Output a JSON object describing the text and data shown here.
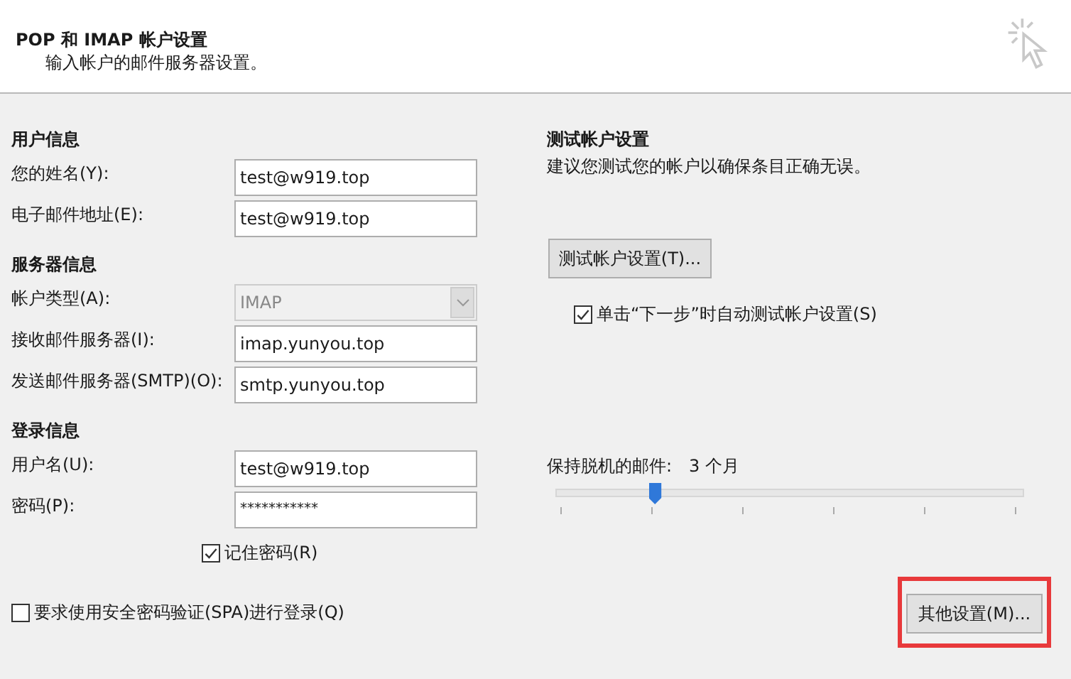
{
  "header": {
    "title": "POP 和 IMAP 帐户设置",
    "subtitle": "输入帐户的邮件服务器设置。"
  },
  "sections": [
    {
      "heading": "用户信息",
      "fields": [
        {
          "kind": "text",
          "label": "您的姓名(Y):",
          "value": "test@w919.top"
        },
        {
          "kind": "text",
          "label": "电子邮件地址(E):",
          "value": "test@w919.top"
        }
      ]
    },
    {
      "heading": "服务器信息",
      "fields": [
        {
          "kind": "dropdown",
          "label": "帐户类型(A):",
          "value": "IMAP",
          "disabled": true
        },
        {
          "kind": "text",
          "label": "接收邮件服务器(I):",
          "value": "imap.yunyou.top"
        },
        {
          "kind": "text",
          "label": "发送邮件服务器(SMTP)(O):",
          "value": "smtp.yunyou.top"
        }
      ]
    },
    {
      "heading": "登录信息",
      "fields": [
        {
          "kind": "text",
          "label": "用户名(U):",
          "value": "test@w919.top"
        },
        {
          "kind": "password",
          "label": "密码(P):",
          "value": "***********"
        }
      ]
    }
  ],
  "remember_password": {
    "label": "记住密码(R)",
    "checked": true
  },
  "spa": {
    "label": "要求使用安全密码验证(SPA)进行登录(Q)",
    "checked": false
  },
  "test": {
    "heading": "测试帐户设置",
    "description": "建议您测试您的帐户以确保条目正确无误。",
    "button": "测试帐户设置(T)...",
    "auto_test": {
      "label": "单击“下一步”时自动测试帐户设置(S)",
      "checked": true
    }
  },
  "offline": {
    "label": "保持脱机的邮件:",
    "value": "3 个月",
    "level": 0.2
  },
  "other_settings": {
    "label": "其他设置(M)...",
    "highlighted": true
  }
}
